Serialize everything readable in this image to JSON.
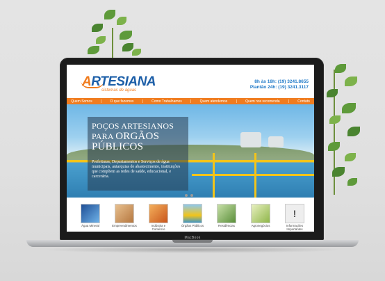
{
  "site": {
    "logo": {
      "text_a": "A",
      "text_rest": "RTESIANA",
      "subtitle": "sistemas de águas"
    },
    "hours": {
      "line1": "8h às 18h: (19) 3241.8655",
      "line2": "Plantão 24h: (19) 3241.3117"
    },
    "nav": [
      "Quem Somos",
      "O que fazemos",
      "Como Trabalhamos",
      "Quem atendemos",
      "Quem nos recomenda",
      "Contato"
    ],
    "hero": {
      "title_line1": "POÇOS ARTESIANOS",
      "title_line2_small": "PARA ",
      "title_line2_big": "ORGÃOS",
      "title_line3": "PÚBLICOS",
      "text": "Prefeituras, Departamentos e Serviços de água municipais, autarquias de abastecimento, instituições que compõem as redes de saúde, educacional, e carcerária."
    },
    "categories": [
      {
        "label": "Água Mineral",
        "color": "#2f6fb6"
      },
      {
        "label": "Empreendimentos",
        "color": "#d9a06a"
      },
      {
        "label": "Indústria e Comércio",
        "color": "#e07a26"
      },
      {
        "label": "Órgãos Públicos",
        "color": "#3f97c8"
      },
      {
        "label": "Residências",
        "color": "#7aa55b"
      },
      {
        "label": "Agronegócios",
        "color": "#a6c35a"
      },
      {
        "label": "Informações Importantes",
        "color": "#bdbdbd"
      }
    ]
  },
  "device": {
    "brand": "MacBook"
  }
}
